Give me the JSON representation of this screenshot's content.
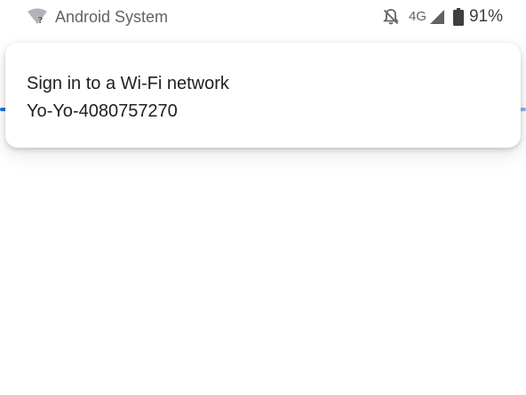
{
  "status_bar": {
    "app_name": "Android System",
    "network_type": "4G",
    "battery_percent": "91%",
    "icons": [
      "wifi-question-icon",
      "bell-off-icon",
      "signal-icon",
      "battery-icon"
    ]
  },
  "notification": {
    "title": "Sign in to a Wi-Fi network",
    "text": "Yo-Yo-4080757270"
  },
  "colors": {
    "accent": "#1a73e8",
    "text_primary": "#202124",
    "text_secondary": "#5f6368"
  }
}
